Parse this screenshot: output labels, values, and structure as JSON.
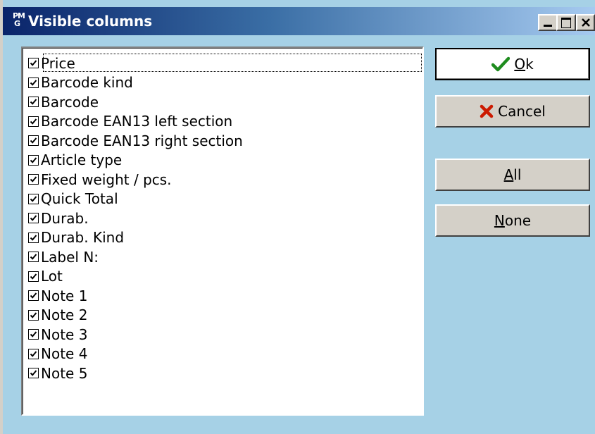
{
  "window": {
    "title": "Visible columns",
    "app_icon_text_top": "PM",
    "app_icon_text_bottom": "G",
    "controls": [
      "minimize",
      "maximize",
      "close"
    ]
  },
  "columns": {
    "items": [
      {
        "label": "Price",
        "checked": true,
        "focused": true
      },
      {
        "label": "Barcode kind",
        "checked": true
      },
      {
        "label": "Barcode",
        "checked": true
      },
      {
        "label": "Barcode EAN13 left section",
        "checked": true
      },
      {
        "label": "Barcode EAN13 right section",
        "checked": true
      },
      {
        "label": "Article type",
        "checked": true
      },
      {
        "label": "Fixed weight / pcs.",
        "checked": true
      },
      {
        "label": "Quick Total",
        "checked": true
      },
      {
        "label": "Durab.",
        "checked": true
      },
      {
        "label": "Durab. Kind",
        "checked": true
      },
      {
        "label": "Label N:",
        "checked": true
      },
      {
        "label": "Lot",
        "checked": true
      },
      {
        "label": "Note 1",
        "checked": true
      },
      {
        "label": "Note 2",
        "checked": true
      },
      {
        "label": "Note 3",
        "checked": true
      },
      {
        "label": "Note 4",
        "checked": true
      },
      {
        "label": "Note 5",
        "checked": true
      }
    ]
  },
  "buttons": {
    "ok": {
      "label": "Ok",
      "mnemonic": "O",
      "icon": "check-icon",
      "color": "#1e8c1e"
    },
    "cancel": {
      "label": "Cancel",
      "icon": "x-icon",
      "color": "#cc1a00"
    },
    "all": {
      "label": "All",
      "mnemonic": "A"
    },
    "none": {
      "label": "None",
      "mnemonic": "N"
    }
  },
  "colors": {
    "dialog_background": "#a6d1e6",
    "titlebar_start": "#0a246a",
    "titlebar_end": "#a6caf0"
  }
}
